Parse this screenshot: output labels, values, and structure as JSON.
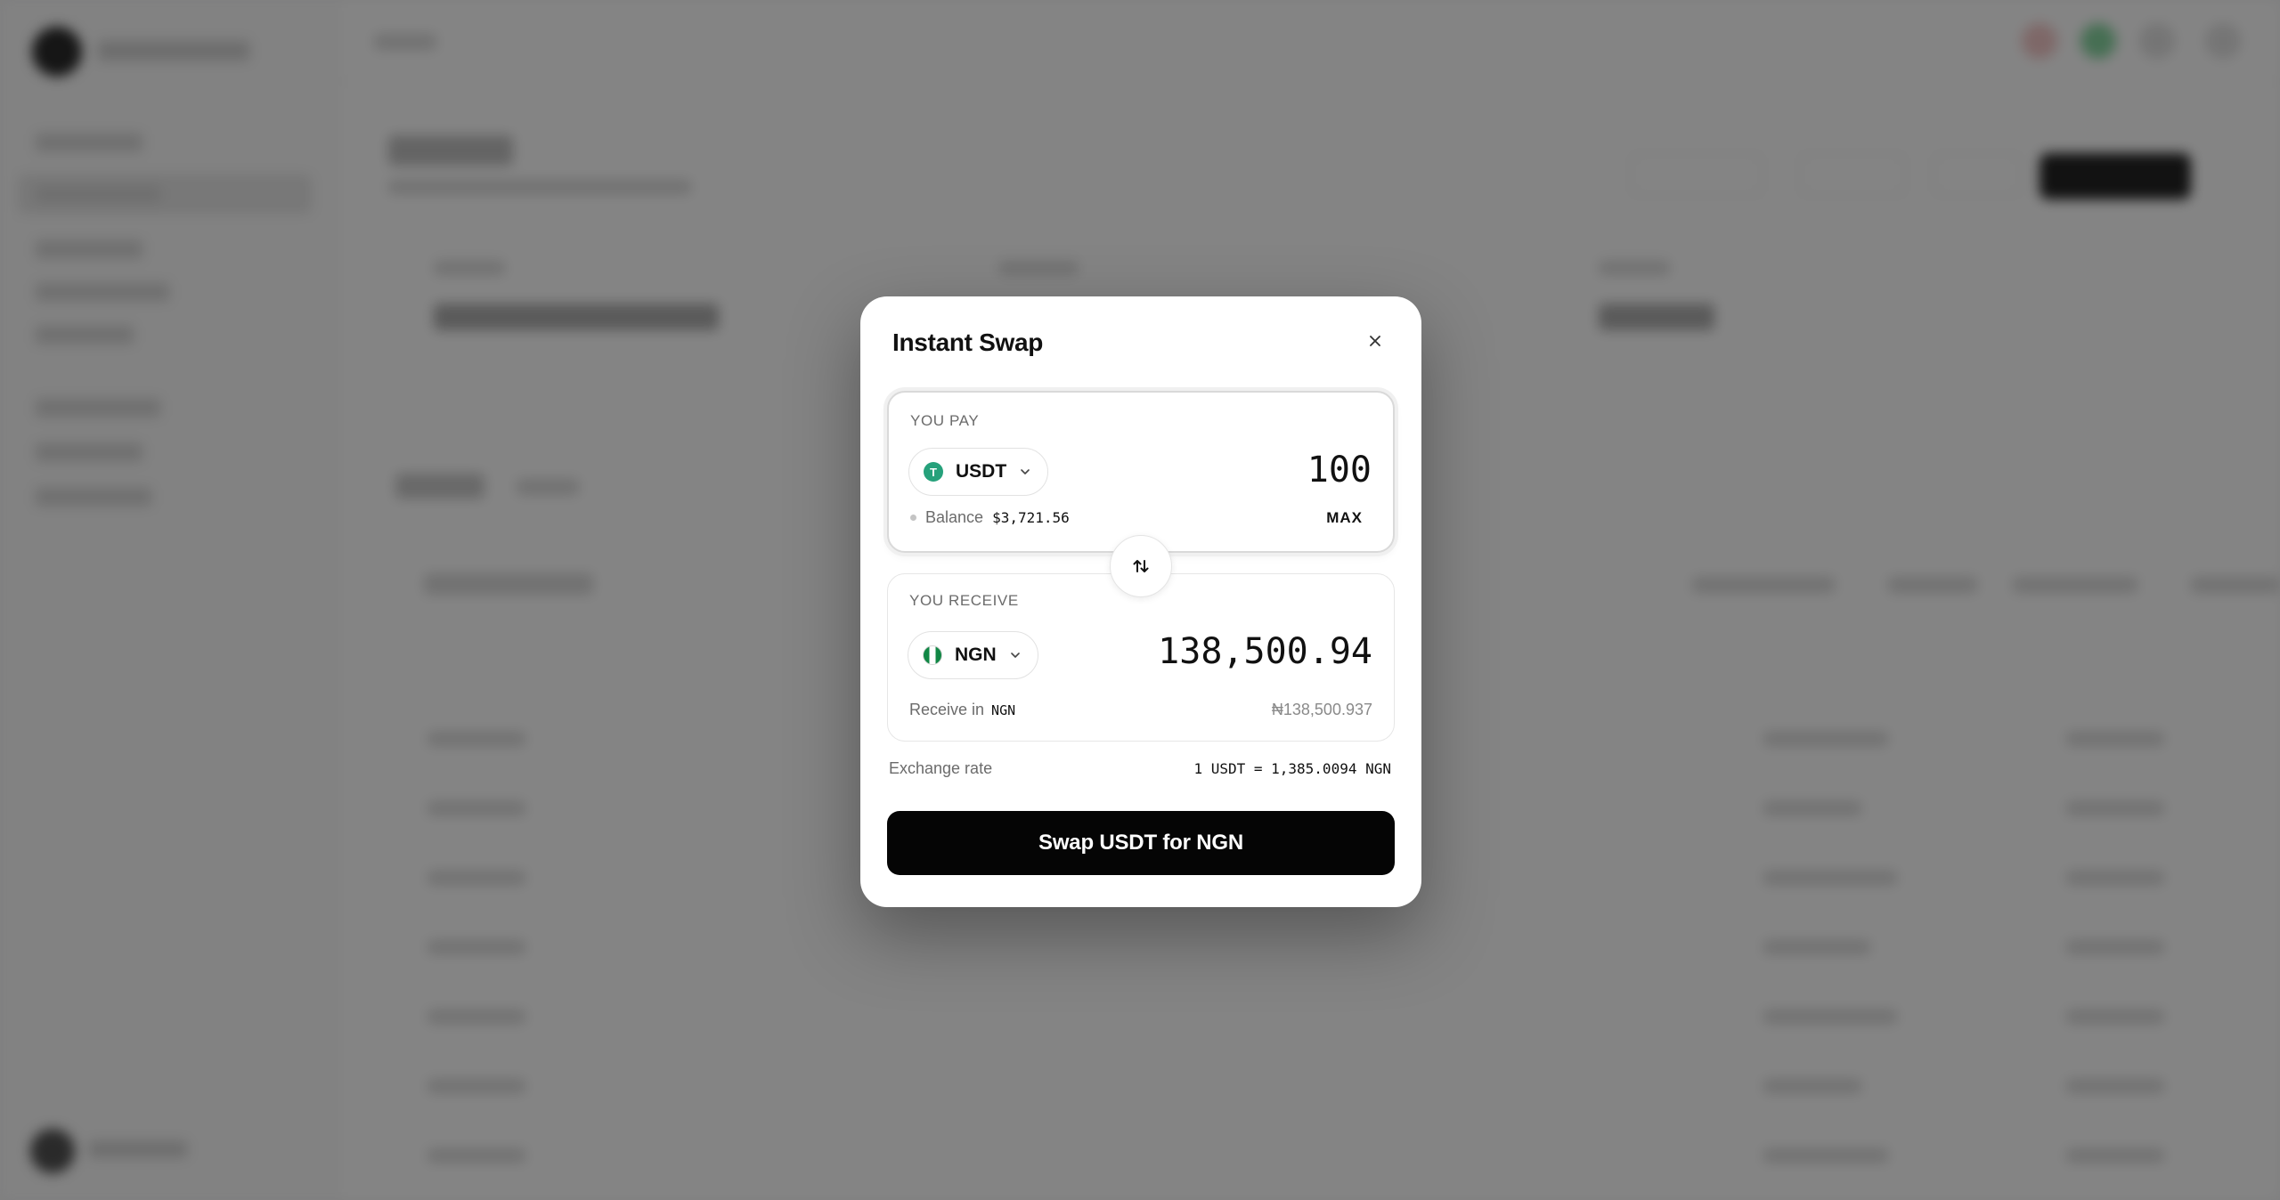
{
  "modal": {
    "title": "Instant Swap",
    "close_icon": "close-icon"
  },
  "pay": {
    "label": "YOU PAY",
    "token": "USDT",
    "token_icon": "tether-icon",
    "amount": "100",
    "balance_label": "Balance",
    "balance_value": "$3,721.56",
    "max_label": "MAX"
  },
  "swap_direction_icon": "swap-arrows-icon",
  "receive": {
    "label": "YOU RECEIVE",
    "token": "NGN",
    "token_icon": "nigeria-flag-icon",
    "amount": "138,500.94",
    "receive_in_label": "Receive in",
    "receive_in_code": "NGN",
    "fiat_value": "₦138,500.937"
  },
  "exchange": {
    "label": "Exchange rate",
    "value": "1 USDT = 1,385.0094 NGN"
  },
  "cta": {
    "label": "Swap USDT for NGN"
  },
  "colors": {
    "usdt": "#26a17b",
    "ngn_green": "#118745",
    "button": "#050505",
    "overlay": "rgba(20,20,20,0.52)"
  }
}
